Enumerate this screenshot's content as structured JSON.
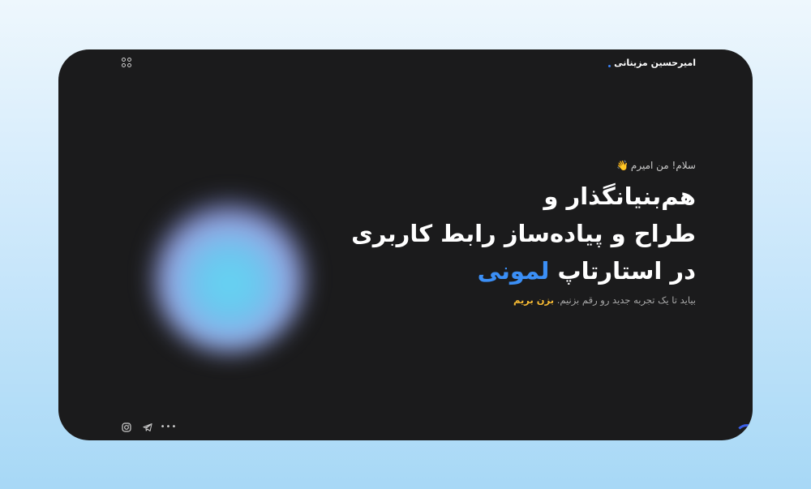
{
  "header": {
    "brand_name": "امیرحسین مزینانی"
  },
  "hero": {
    "greeting": "سلام! من امیرم",
    "greeting_emoji": "👋",
    "headline_line1": "هم‌بنیانگذار و",
    "headline_line2": "طراح و پیاده‌ساز رابط کاربری",
    "headline_line3_prefix": "در استارتاپ",
    "headline_accent": "لمونی",
    "subline": "بیاید تا یک تجربه جدید رو رقم بزنیم.",
    "cta_label": "بزن بریم"
  },
  "footer": {
    "more_label": "•••"
  },
  "colors": {
    "page_background": "#cfe9fb",
    "card_background": "#1b1b1c",
    "accent_blue": "#3b8ff6",
    "accent_yellow": "#f5b933"
  },
  "icons": [
    "menu-grid-icon",
    "instagram-icon",
    "telegram-icon",
    "more-dots-icon"
  ]
}
